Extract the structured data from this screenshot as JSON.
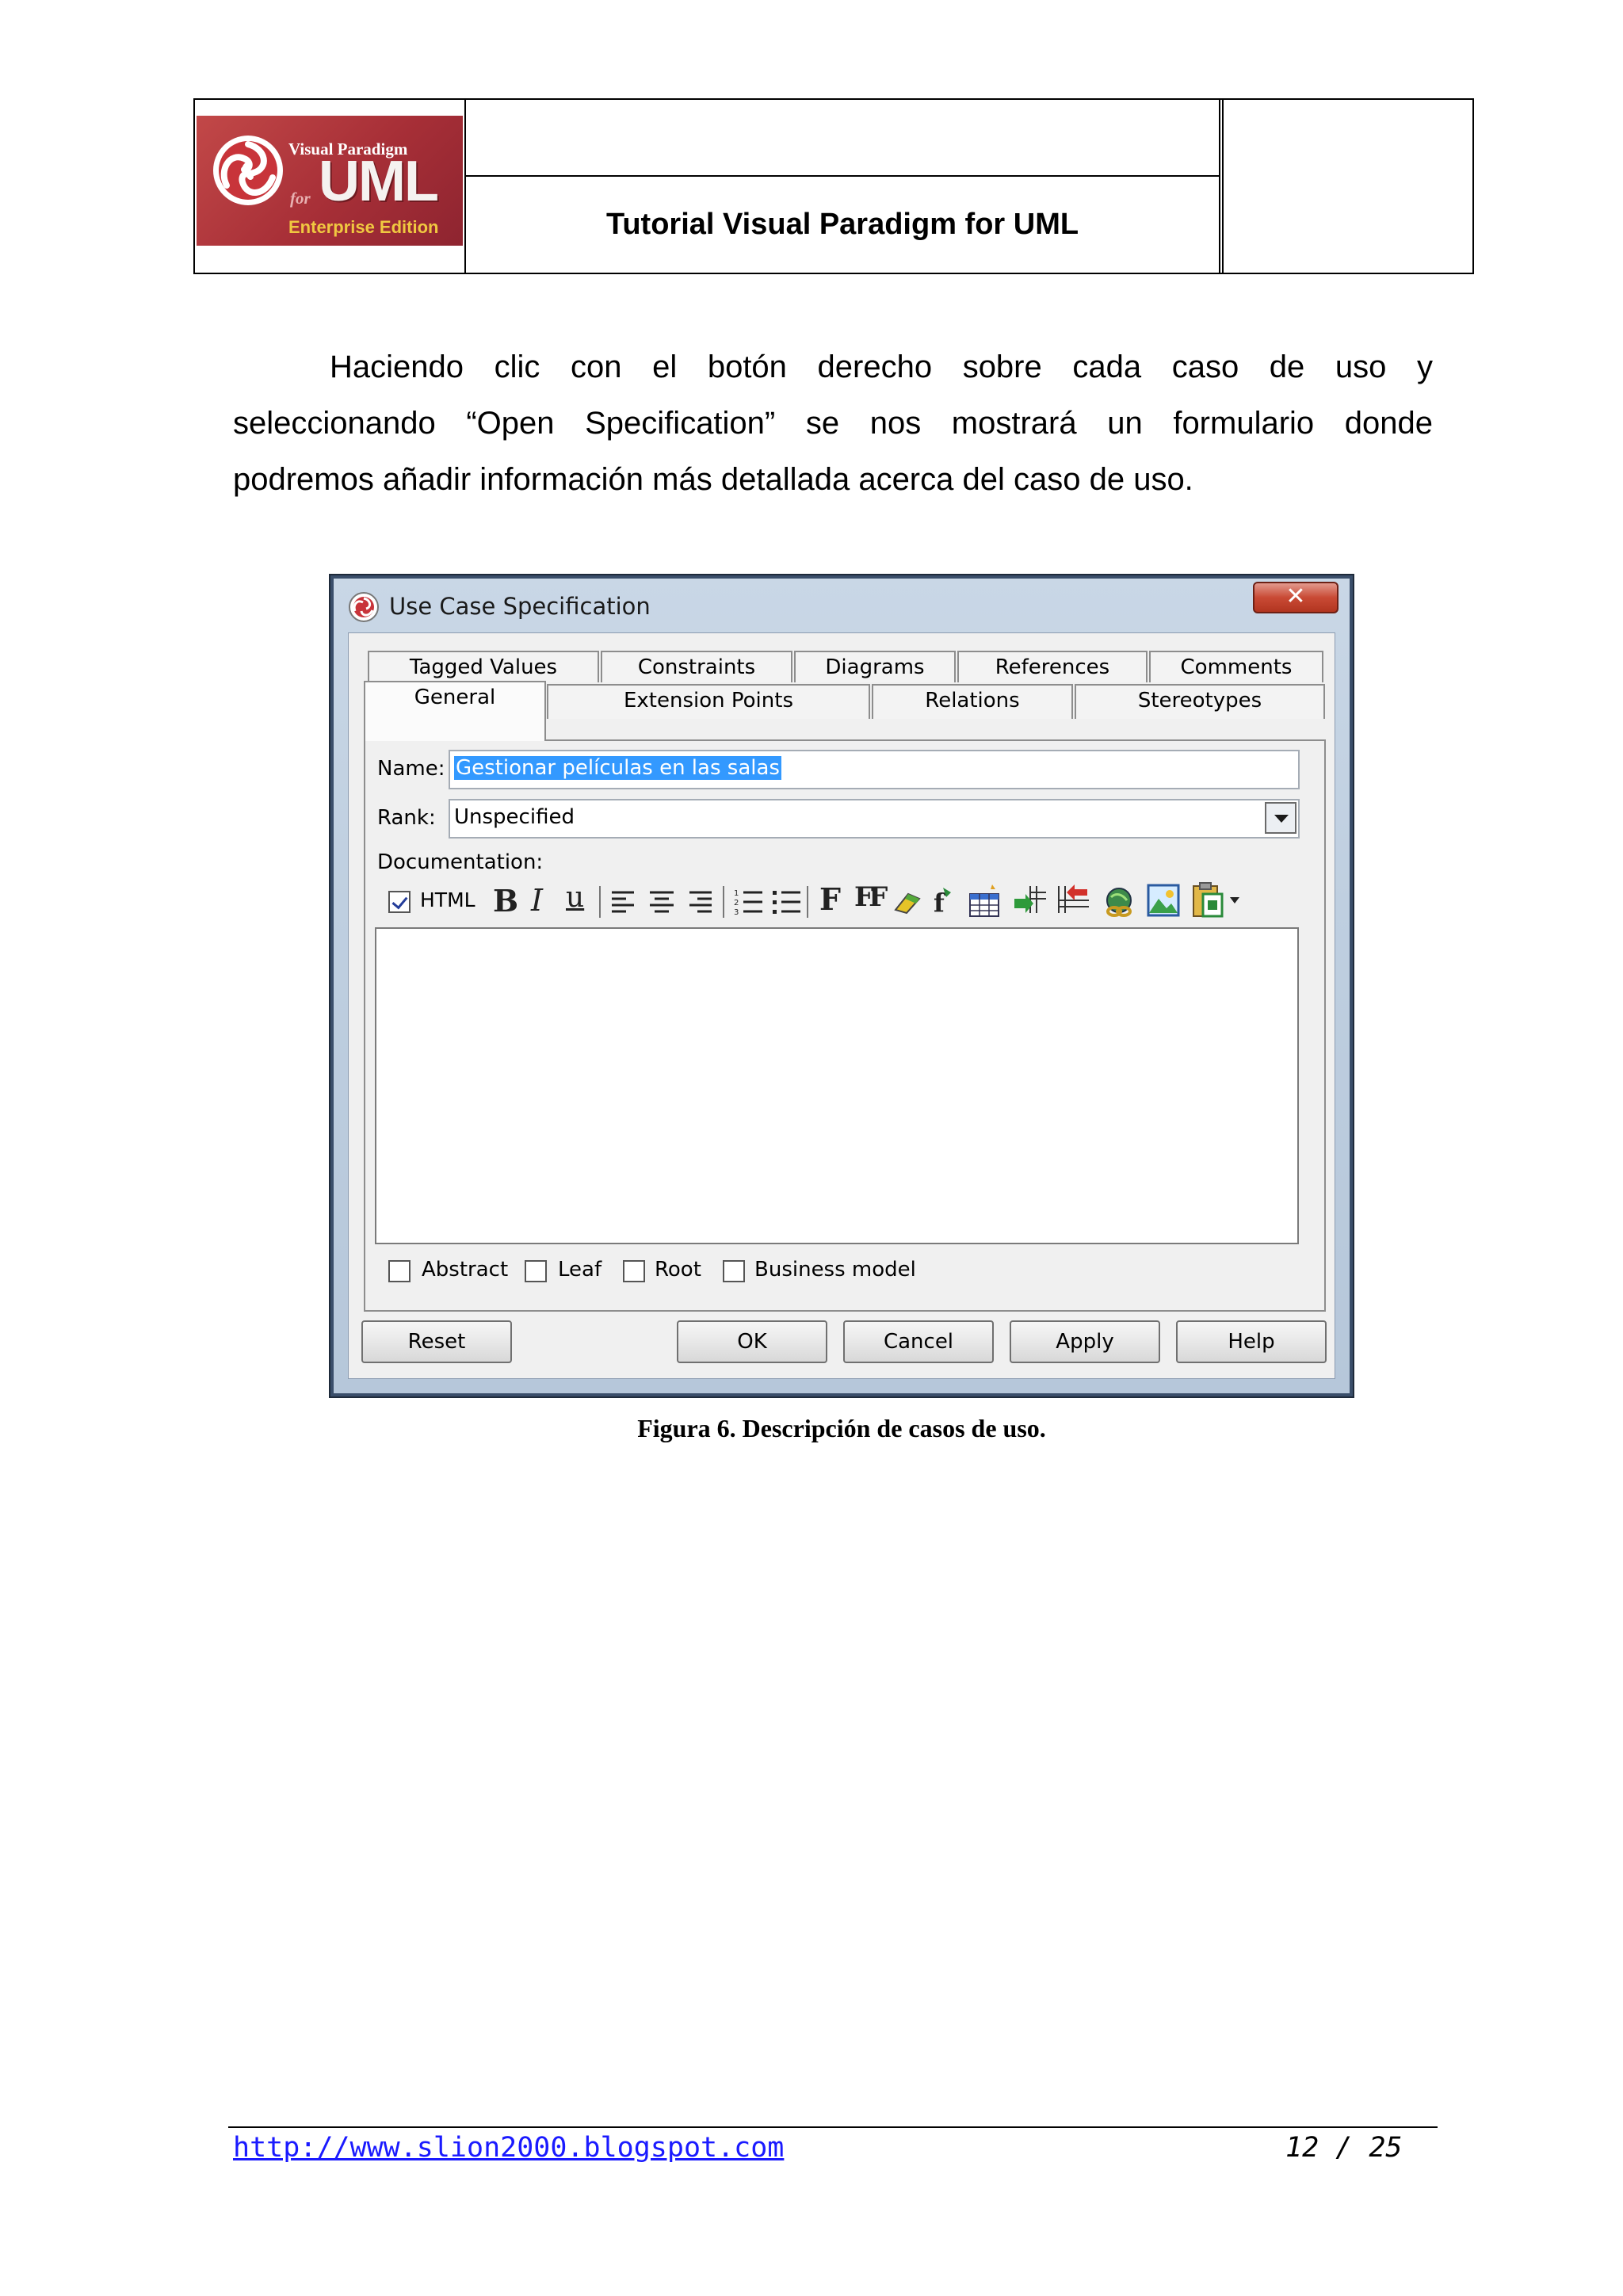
{
  "header": {
    "title": "Tutorial Visual Paradigm for UML",
    "logo": {
      "line1": "Visual Paradigm",
      "for": "for",
      "uml": "UML",
      "edition": "Enterprise Edition"
    }
  },
  "paragraph": {
    "lines": [
      "Haciendo clic con el botón derecho sobre cada caso de uso y",
      "seleccionando “Open Specification” se nos mostrará un formulario donde",
      "podremos añadir información más detallada acerca del caso de uso."
    ]
  },
  "dialog": {
    "title": "Use Case Specification",
    "close_glyph": "✕",
    "tabs_row1": [
      "Tagged Values",
      "Constraints",
      "Diagrams",
      "References",
      "Comments"
    ],
    "tabs_row2": [
      "General",
      "Extension Points",
      "Relations",
      "Stereotypes"
    ],
    "active_tab": "General",
    "name_label": "Name:",
    "name_value": "Gestionar películas en las salas",
    "rank_label": "Rank:",
    "rank_value": "Unspecified",
    "documentation_label": "Documentation:",
    "html_label": "HTML",
    "html_checked": true,
    "toolbar": {
      "bold": "B",
      "italic": "I",
      "underline": "u",
      "font": "F",
      "font_size": "FF"
    },
    "checkboxes": [
      {
        "label": "Abstract",
        "checked": false
      },
      {
        "label": "Leaf",
        "checked": false
      },
      {
        "label": "Root",
        "checked": false
      },
      {
        "label": "Business model",
        "checked": false
      }
    ],
    "buttons": {
      "reset": "Reset",
      "ok": "OK",
      "cancel": "Cancel",
      "apply": "Apply",
      "help": "Help"
    }
  },
  "caption": "Figura 6. Descripción de casos de uso.",
  "footer": {
    "url": "http://www.slion2000.blogspot.com",
    "page": "12 / 25"
  },
  "colors": {
    "selection": "#3399ff",
    "link": "#1a1aff",
    "close_button": "#c94a35"
  }
}
